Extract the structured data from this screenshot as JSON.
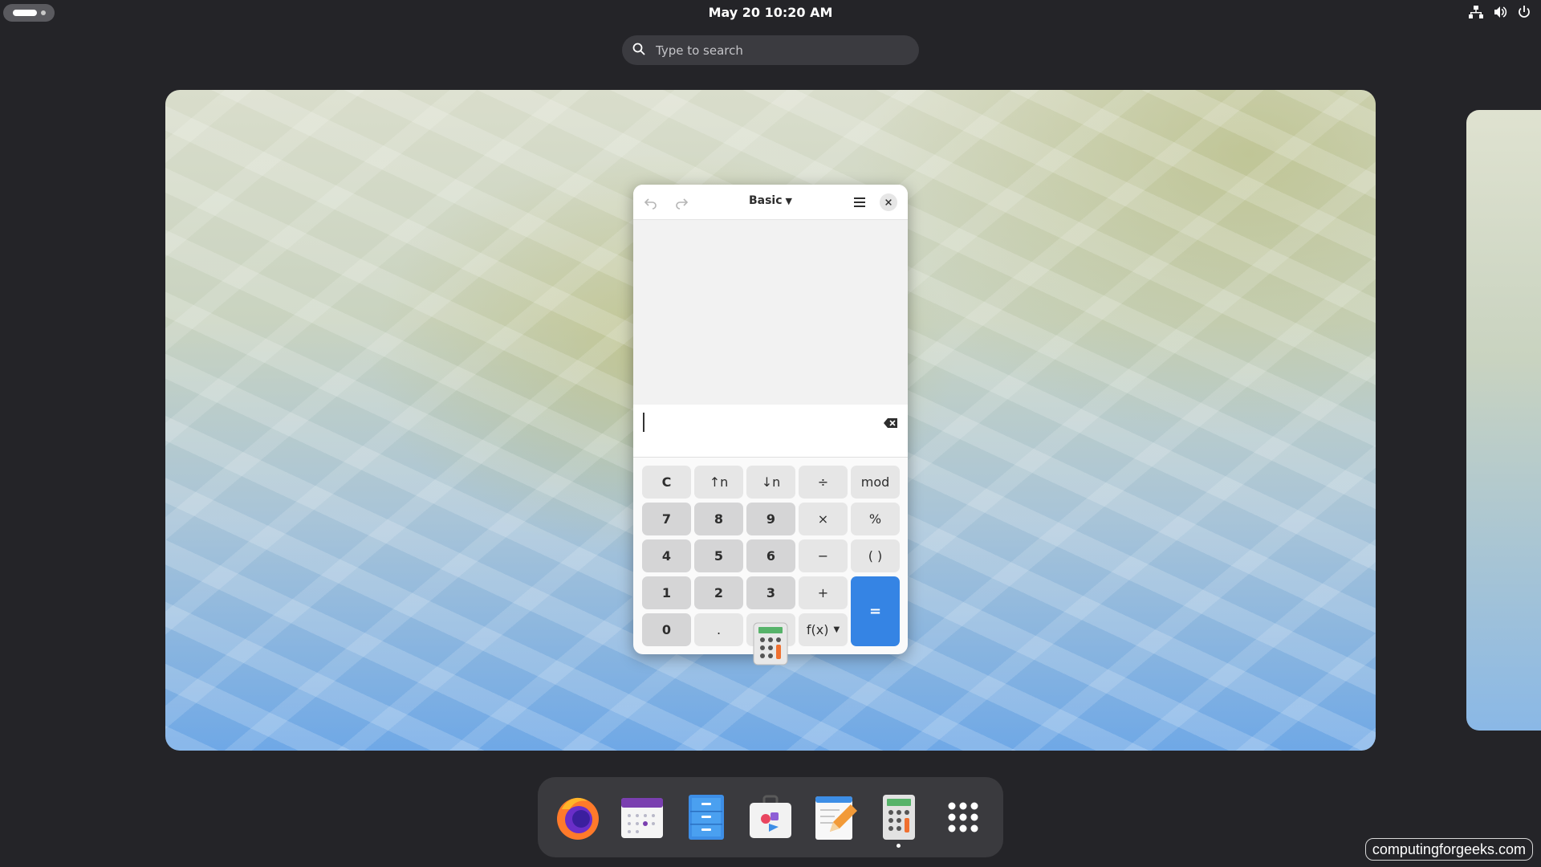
{
  "topbar": {
    "clock": "May 20  10:20 AM",
    "tray_icons": [
      "network-icon",
      "volume-icon",
      "power-icon"
    ]
  },
  "search": {
    "placeholder": "Type to search"
  },
  "calculator": {
    "mode_label": "Basic",
    "display": "",
    "keys": {
      "clear": "C",
      "pow_up": "↑n",
      "pow_down": "↓n",
      "divide": "÷",
      "mod": "mod",
      "k7": "7",
      "k8": "8",
      "k9": "9",
      "multiply": "×",
      "percent": "%",
      "k4": "4",
      "k5": "5",
      "k6": "6",
      "subtract": "−",
      "parens": "( )",
      "k1": "1",
      "k2": "2",
      "k3": "3",
      "add": "+",
      "equals": "=",
      "k0": "0",
      "decimal": ".",
      "fx": "f(x)"
    }
  },
  "dock": {
    "items": [
      "firefox-icon",
      "calendar-icon",
      "files-icon",
      "software-icon",
      "text-editor-icon",
      "calculator-icon",
      "app-grid-icon"
    ]
  },
  "watermark": "computingforgeeks.com",
  "colors": {
    "accent": "#3584e4",
    "panel": "#242428"
  }
}
